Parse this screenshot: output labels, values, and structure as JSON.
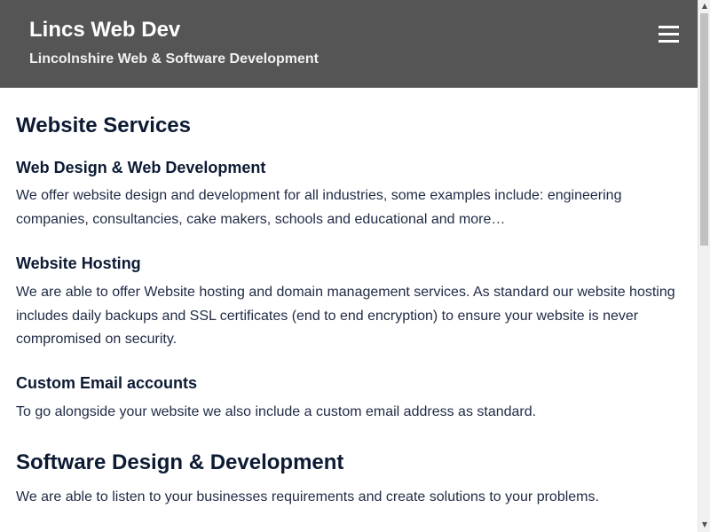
{
  "header": {
    "title": "Lincs Web Dev",
    "tagline": "Lincolnshire Web & Software Development",
    "menu_icon": "hamburger-menu-icon"
  },
  "main": {
    "website_services": {
      "heading": "Website Services",
      "items": [
        {
          "title": "Web Design & Web Development",
          "text": "We offer website design and development for all industries, some examples include: engineering companies, consultancies, cake makers, schools and educational and more…"
        },
        {
          "title": "Website Hosting",
          "text": "We are able to offer Website hosting and domain management services. As standard our website hosting includes daily backups and SSL certificates (end to end encryption) to ensure your website is never compromised on security."
        },
        {
          "title": "Custom Email accounts",
          "text": "To go alongside your website we also include a custom email address as standard."
        }
      ]
    },
    "software_design": {
      "heading": "Software Design & Development",
      "text": "We are able to listen to your businesses requirements and create solutions to your problems."
    }
  },
  "scrollbar": {
    "up_icon": "scroll-up-arrow-icon",
    "down_icon": "scroll-down-arrow-icon"
  },
  "colors": {
    "header_bg": "#555555",
    "header_text": "#ffffff",
    "heading_text": "#0c1a33",
    "body_text": "#1f2a44"
  }
}
